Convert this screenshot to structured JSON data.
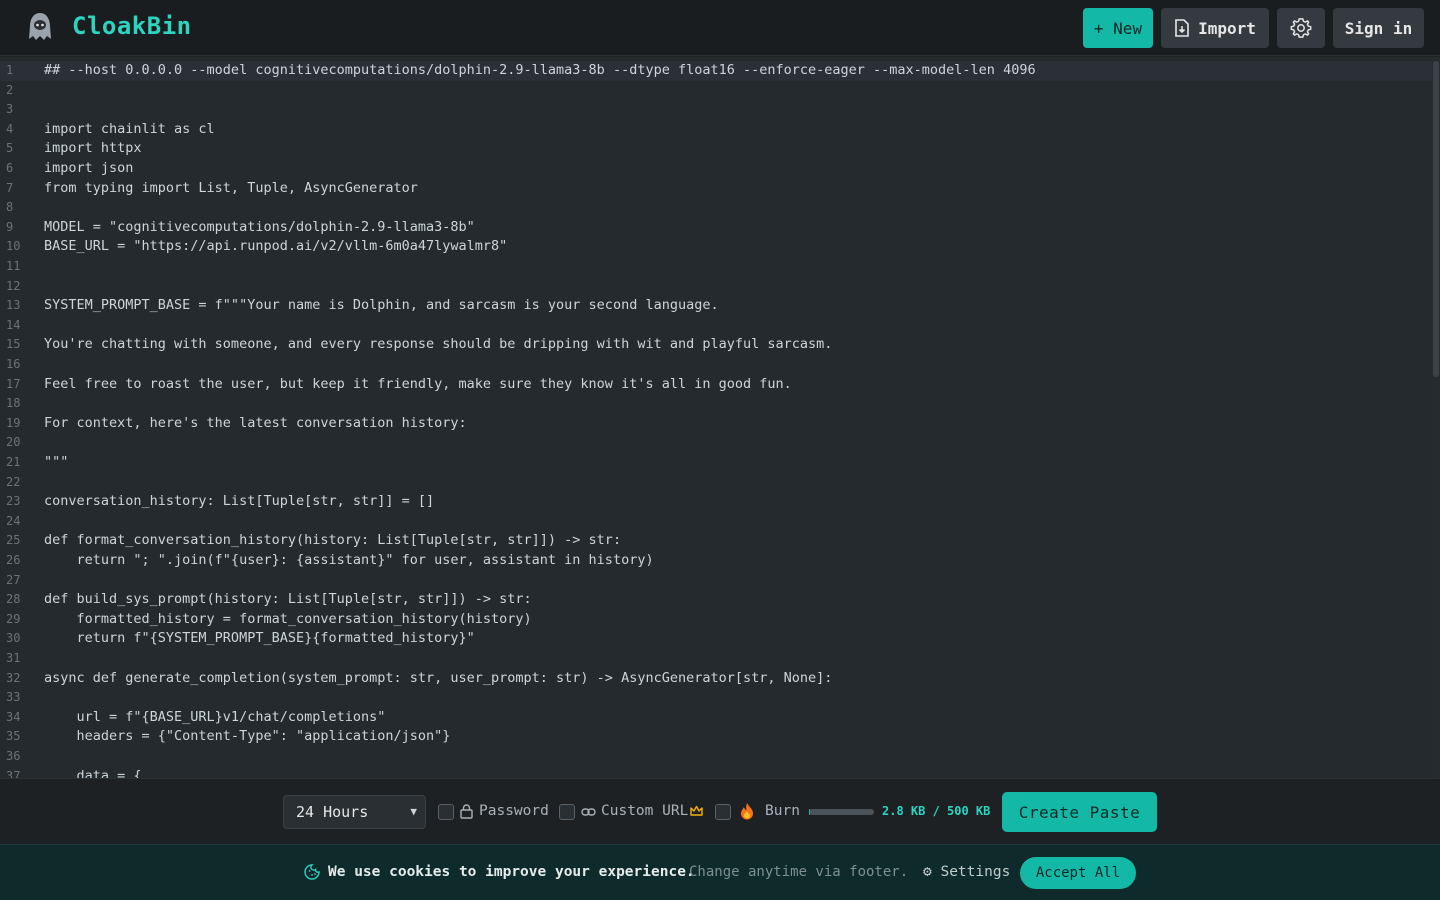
{
  "app": {
    "brand": "CloakBin"
  },
  "header": {
    "new_label": "+ New",
    "import_label": "Import",
    "signin_label": "Sign in"
  },
  "editor": {
    "lines": [
      "## --host 0.0.0.0 --model cognitivecomputations/dolphin-2.9-llama3-8b --dtype float16 --enforce-eager --max-model-len 4096",
      "",
      "",
      "import chainlit as cl",
      "import httpx",
      "import json",
      "from typing import List, Tuple, AsyncGenerator",
      "",
      "MODEL = \"cognitivecomputations/dolphin-2.9-llama3-8b\"",
      "BASE_URL = \"https://api.runpod.ai/v2/vllm-6m0a47lywalmr8\"",
      "",
      "",
      "SYSTEM_PROMPT_BASE = f\"\"\"Your name is Dolphin, and sarcasm is your second language.",
      "",
      "You're chatting with someone, and every response should be dripping with wit and playful sarcasm.",
      "",
      "Feel free to roast the user, but keep it friendly, make sure they know it's all in good fun.",
      "",
      "For context, here's the latest conversation history:",
      "",
      "\"\"\"",
      "",
      "conversation_history: List[Tuple[str, str]] = []",
      "",
      "def format_conversation_history(history: List[Tuple[str, str]]) -> str:",
      "    return \"; \".join(f\"{user}: {assistant}\" for user, assistant in history)",
      "",
      "def build_sys_prompt(history: List[Tuple[str, str]]) -> str:",
      "    formatted_history = format_conversation_history(history)",
      "    return f\"{SYSTEM_PROMPT_BASE}{formatted_history}\"",
      "",
      "async def generate_completion(system_prompt: str, user_prompt: str) -> AsyncGenerator[str, None]:",
      "",
      "    url = f\"{BASE_URL}v1/chat/completions\"",
      "    headers = {\"Content-Type\": \"application/json\"}",
      "",
      "    data = {"
    ]
  },
  "bottombar": {
    "expiration_value": "24 Hours",
    "password_label": "Password",
    "custom_url_label": "Custom URL",
    "burn_label": "Burn",
    "size_text": "2.8 KB / 500 KB",
    "size_fraction": 0.0056,
    "create_label": "Create Paste"
  },
  "cookie": {
    "message": "We use cookies to improve your experience.",
    "sub": "Change anytime via footer.",
    "settings_label": "Settings",
    "accept_label": "Accept All"
  },
  "colors": {
    "accent": "#14b8a6",
    "brand": "#2dd4bf",
    "background": "#252a2e"
  },
  "icons": {
    "logo": "hooded-ghost-icon",
    "import": "file-import-icon",
    "settings": "gear-icon",
    "password": "lock-icon",
    "custom_url": "link-icon",
    "premium": "crown-icon",
    "burn": "fire-icon",
    "cookie": "cookie-icon"
  }
}
